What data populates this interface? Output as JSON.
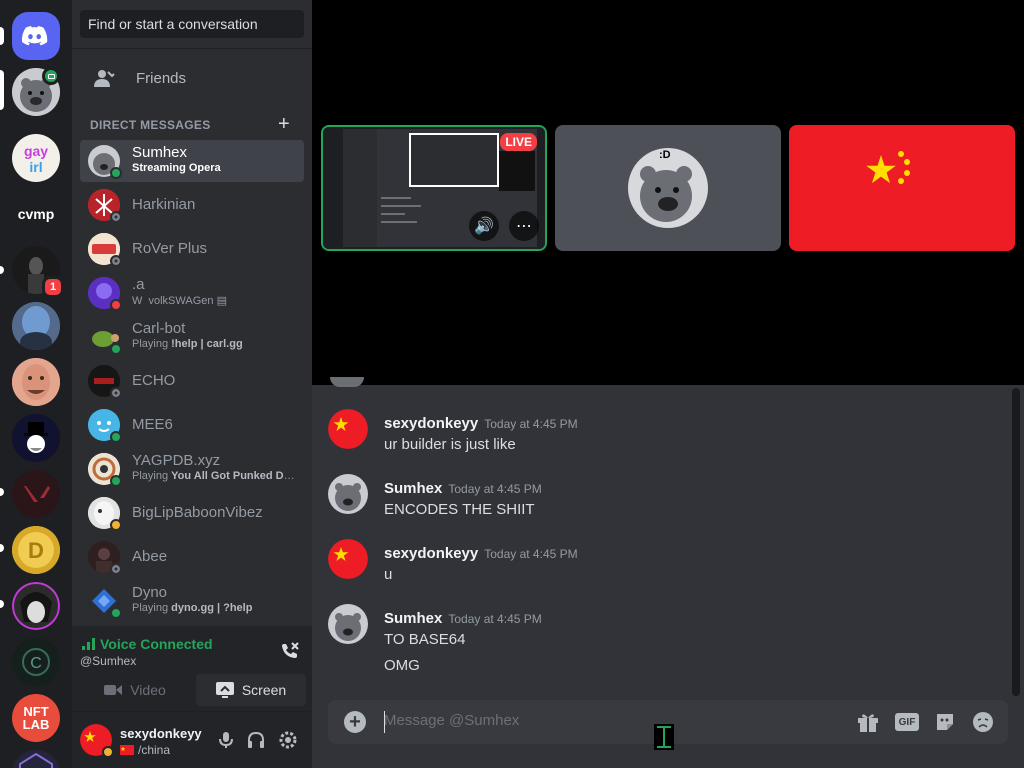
{
  "search": {
    "placeholder": "Find or start a conversation"
  },
  "nav": {
    "friends_label": "Friends"
  },
  "dm_section": {
    "header": "DIRECT MESSAGES"
  },
  "direct_messages": [
    {
      "name": "Sumhex",
      "subtitle_prefix": "Streaming ",
      "subtitle_bold": "Opera",
      "status": "online",
      "selected": true
    },
    {
      "name": "Harkinian",
      "status": "offline"
    },
    {
      "name": "RoVer Plus",
      "status": "offline"
    },
    {
      "name": ".a",
      "subtitle_prefix": "volkSWAGen",
      "status": "dnd"
    },
    {
      "name": "Carl-bot",
      "subtitle_prefix": "Playing ",
      "subtitle_bold": "!help | carl.gg",
      "status": "online"
    },
    {
      "name": "ECHO",
      "status": "offline"
    },
    {
      "name": "MEE6",
      "status": "online"
    },
    {
      "name": "YAGPDB.xyz",
      "subtitle_prefix": "Playing ",
      "subtitle_bold": "You All Got Punked Du...",
      "status": "online"
    },
    {
      "name": "BigLipBaboonVibez",
      "status": "idle"
    },
    {
      "name": "Abee",
      "status": "offline"
    },
    {
      "name": "Dyno",
      "subtitle_prefix": "Playing ",
      "subtitle_bold": "dyno.gg | ?help",
      "status": "online"
    }
  ],
  "servers": {
    "cvmp_label": "cvmp",
    "badge_count": "1",
    "nftlab_line1": "NFT",
    "nftlab_line2": "LAB"
  },
  "voice": {
    "status": "Voice Connected",
    "user": "@Sumhex",
    "video_label": "Video",
    "screen_label": "Screen"
  },
  "user_panel": {
    "username": "sexydonkeyy",
    "status_text": "/china"
  },
  "call": {
    "live_label": "LIVE",
    "avatar_text": ":D"
  },
  "messages": [
    {
      "author": "sexydonkeyy",
      "time": "Today at 4:45 PM",
      "lines": [
        "ur builder is just  like"
      ],
      "avatar": "china-flag"
    },
    {
      "author": "Sumhex",
      "time": "Today at 4:45 PM",
      "lines": [
        "ENCODES THE SHIIT"
      ],
      "avatar": "sumhex"
    },
    {
      "author": "sexydonkeyy",
      "time": "Today at 4:45 PM",
      "lines": [
        "u"
      ],
      "avatar": "china-flag"
    },
    {
      "author": "Sumhex",
      "time": "Today at 4:45 PM",
      "lines": [
        "TO BASE64",
        "OMG"
      ],
      "avatar": "sumhex"
    }
  ],
  "composer": {
    "placeholder": "Message @Sumhex",
    "gif_label": "GIF"
  },
  "colors": {
    "online": "#23a55a",
    "dnd": "#f23f43",
    "idle": "#f0b232",
    "blurple": "#5865f2",
    "china_red": "#ee1c25",
    "china_yellow": "#ffde00"
  }
}
